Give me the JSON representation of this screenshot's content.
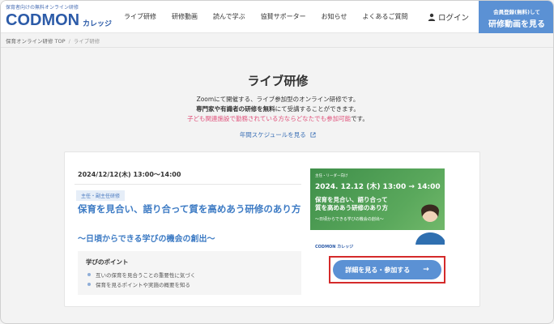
{
  "header": {
    "logo_tagline": "保育者向けの無料オンライン研修",
    "logo_main": "CODMON",
    "logo_sub": "カレッジ",
    "nav": [
      "ライブ研修",
      "研修動画",
      "読んで学ぶ",
      "協賛サポーター",
      "お知らせ",
      "よくあるご質問"
    ],
    "login_label": "ログイン",
    "cta_line1": "会員登録(無料)して",
    "cta_line2": "研修動画を見る"
  },
  "breadcrumb": {
    "home": "保育オンライン研修 TOP",
    "current": "ライブ研修"
  },
  "main": {
    "title": "ライブ研修",
    "intro_line1": "Zoomにて開催する、ライブ参加型のオンライン研修です。",
    "intro_line2_bold": "専門家や有識者の研修を無料",
    "intro_line2_rest": "にて受講することができます。",
    "intro_line3_pink": "子ども関連施設で勤務されている方ならどなたでも参加可能",
    "intro_line3_rest": "です。",
    "schedule_link": "年間スケジュールを見る"
  },
  "card": {
    "date": "2024/12/12(木) 13:00〜14:00",
    "tag": "主任・副主任研修",
    "title": "保育を見合い、語り合って質を高めあう研修のあり方",
    "subtitle": "〜日頃からできる学びの機会の創出〜",
    "points_heading": "学びのポイント",
    "points": [
      "互いの保育を見合うことの重要性に気づく",
      "保育を見るポイントや実施の概要を知る"
    ],
    "detail_button": "詳細を見る・参加する"
  },
  "banner": {
    "top": "主任・リーダー向け",
    "date_text": "2024. 12.12 (木) 13:00 → 14:00",
    "title_line1": "保育を見合い、語り合って",
    "title_line2": "質を高めあう研修のあり方",
    "subtitle": "〜日頃からできる学びの機会の創出〜",
    "logo": "CODMON カレッジ"
  },
  "colors": {
    "accent": "#5b91d4",
    "title_blue": "#3d7bc4",
    "pink": "#e0507a",
    "highlight_border": "#d42a2a"
  }
}
